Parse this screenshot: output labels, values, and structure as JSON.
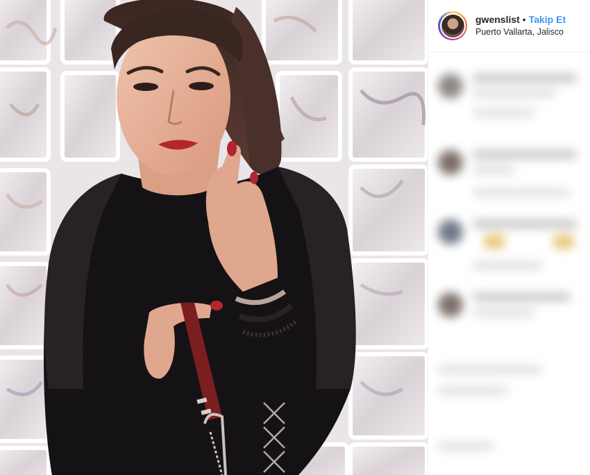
{
  "post": {
    "username": "gwenslist",
    "separator": "•",
    "follow_label": "Takip Et",
    "location": "Puerto Vallarta, Jalisco"
  },
  "photo": {
    "icon": "photo",
    "accent_lipstick": "#b3262d"
  },
  "comments": {
    "state": "blurred",
    "count_visible": 4
  },
  "colors": {
    "follow": "#3897f0",
    "text": "#262626",
    "border": "#efefef"
  }
}
